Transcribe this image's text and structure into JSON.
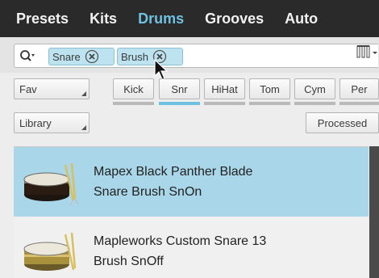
{
  "tabs": [
    "Presets",
    "Kits",
    "Drums",
    "Grooves",
    "Auto"
  ],
  "active_tab": "Drums",
  "search": {
    "tags": [
      "Snare",
      "Brush"
    ]
  },
  "filters": {
    "fav_label": "Fav",
    "library_label": "Library",
    "processed_label": "Processed",
    "types": [
      "Kick",
      "Snr",
      "HiHat",
      "Tom",
      "Cym",
      "Per"
    ],
    "selected_type": "Snr"
  },
  "results": [
    {
      "line1": "Mapex Black Panther Blade",
      "line2": "Snare Brush SnOn",
      "selected": true
    },
    {
      "line1": "Mapleworks Custom Snare 13",
      "line2": "Brush SnOff",
      "selected": false
    }
  ],
  "colors": {
    "accent": "#6fc1e2",
    "selection": "#a9d6e8",
    "tab_bar": "#2a2a2a"
  }
}
